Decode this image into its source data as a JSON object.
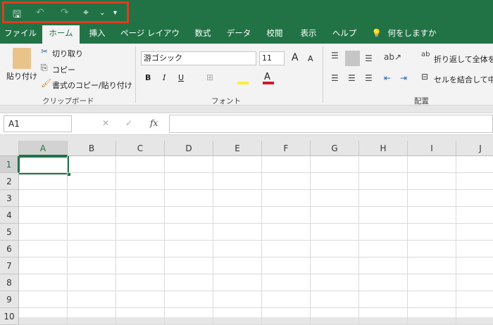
{
  "qat": {
    "save": "🖫",
    "undo": "↶",
    "redo": "↷",
    "touch": "⌖",
    "more": "▾"
  },
  "tabs": [
    "ファイル",
    "ホーム",
    "挿入",
    "ページ レイアウト",
    "数式",
    "データ",
    "校閲",
    "表示",
    "ヘルプ"
  ],
  "tell_me": "何をしますか",
  "clipboard": {
    "paste": "貼り付け",
    "cut": "切り取り",
    "copy": "コピー",
    "format_painter": "書式のコピー/貼り付け",
    "group": "クリップボード"
  },
  "font": {
    "name": "游ゴシック",
    "size": "11",
    "bold": "B",
    "italic": "I",
    "underline": "U",
    "group": "フォント",
    "grow": "A",
    "shrink": "A",
    "color_a": "A"
  },
  "alignment": {
    "wrap": "折り返して全体を表",
    "merge": "セルを結合して中央",
    "group": "配置"
  },
  "formula_bar": {
    "name_box": "A1",
    "fx": "fx",
    "cancel": "✕",
    "enter": "✓",
    "value": ""
  },
  "columns": [
    "A",
    "B",
    "C",
    "D",
    "E",
    "F",
    "G",
    "H",
    "I",
    "J"
  ],
  "rows": [
    "1",
    "2",
    "3",
    "4",
    "5",
    "6",
    "7",
    "8",
    "9",
    "10"
  ],
  "active_cell": "A1"
}
